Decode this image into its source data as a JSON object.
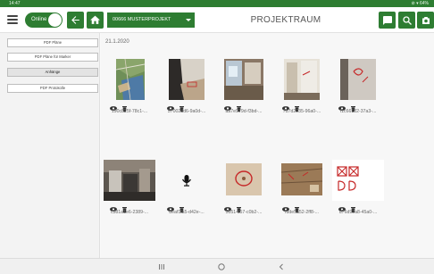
{
  "status_bar": {
    "time": "14:47",
    "right_text": "⊘ ▾ 64%",
    "color": "#2e7d32"
  },
  "app_bar": {
    "online_label": "Online",
    "project_select": "00666 MUSTERPROJEKT",
    "title": "PROJEKTRAUM"
  },
  "sidebar": {
    "buttons": [
      {
        "label": "PDF Pläne"
      },
      {
        "label": "PDF Pläne für Marker"
      },
      {
        "label": "Anhänge",
        "active": true
      },
      {
        "label": "PDF Protokolle"
      }
    ]
  },
  "content": {
    "date": "21.1.2020",
    "attachments": [
      {
        "name": "190c825f-78c1-...",
        "icon": "map-photo"
      },
      {
        "name": "57002dd6-9a0d-...",
        "icon": "wall-corner-photo"
      },
      {
        "name": "aa7e979d-f3bd-...",
        "icon": "room-photo"
      },
      {
        "name": "7d7d2735-96a0-...",
        "icon": "door-photo"
      },
      {
        "name": "f1c66132-37a3-...",
        "icon": "wall-marked-photo"
      },
      {
        "name": "c381a1e6-2389-...",
        "icon": "kitchen-photo"
      },
      {
        "name": "8eaf1fa5-d42e-...",
        "icon": "microphone-icon"
      },
      {
        "name": "50514f57-c0b2-...",
        "icon": "circled-spot-photo"
      },
      {
        "name": "fdde5a52-2ff8-...",
        "icon": "floor-photo"
      },
      {
        "name": "d76d97a8-45a0-...",
        "icon": "sketch-photo"
      }
    ]
  },
  "nav_bar": {
    "buttons": [
      "recent-apps-icon",
      "home-icon",
      "back-icon"
    ]
  },
  "colors": {
    "accent": "#2e7d32",
    "background": "#fafafa"
  }
}
